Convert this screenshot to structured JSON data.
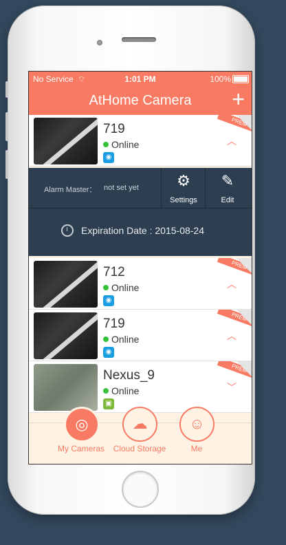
{
  "status_bar": {
    "carrier": "No Service",
    "time": "1:01 PM",
    "battery": "100%"
  },
  "nav": {
    "title": "AtHome Camera",
    "add_label": "+"
  },
  "cameras": [
    {
      "name": "719",
      "status": "Online",
      "os": "ios",
      "badge": "PREM"
    },
    {
      "name": "712",
      "status": "Online",
      "os": "ios",
      "badge": "PREM"
    },
    {
      "name": "719",
      "status": "Online",
      "os": "ios",
      "badge": "PREM"
    },
    {
      "name": "Nexus_9",
      "status": "Online",
      "os": "android",
      "badge": "PREM"
    }
  ],
  "detail": {
    "alarm_label": "Alarm Master：",
    "alarm_value": "not set yet",
    "settings_label": "Settings",
    "edit_label": "Edit",
    "expiration": "Expiration Date : 2015-08-24"
  },
  "tabs": [
    {
      "label": "My Cameras"
    },
    {
      "label": "Cloud Storage"
    },
    {
      "label": "Me"
    }
  ],
  "colors": {
    "accent": "#f97a62",
    "panel": "#2c3e50",
    "online": "#35c03a",
    "background": "#34495e"
  }
}
